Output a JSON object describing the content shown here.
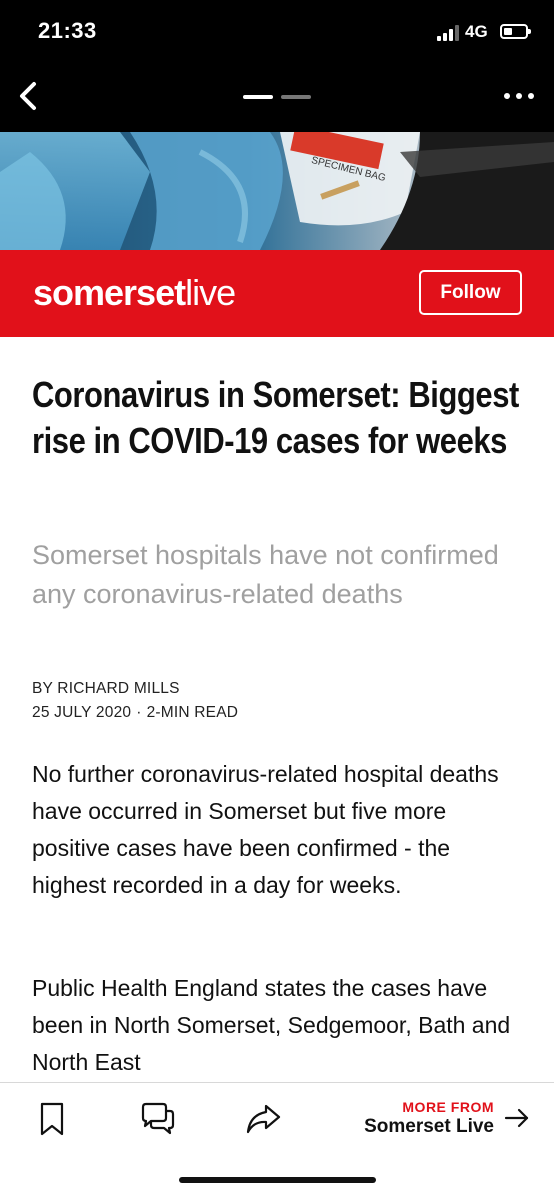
{
  "status_bar": {
    "time": "21:33",
    "network": "4G",
    "signal_bars": 3,
    "battery_level": 0.4
  },
  "nav": {
    "back_icon": "chevron-left-icon",
    "more_icon": "ellipsis-icon",
    "pages": 2,
    "active_page": 1
  },
  "brand": {
    "logo_part1": "somerset",
    "logo_part2": "live",
    "follow_label": "Follow",
    "color": "#e1111a"
  },
  "article": {
    "headline": "Coronavirus in Somerset: Biggest rise in COVID-19 cases for weeks",
    "subheadline": "Somerset hospitals have not confirmed any coronavirus-related deaths",
    "byline": "BY RICHARD MILLS",
    "date": "25 JULY 2020",
    "separator": "·",
    "read_time": "2-MIN READ",
    "paragraphs": [
      "No further coronavirus-related hospital deaths have occurred in Somerset but five more positive cases have been confirmed - the highest recorded in a day for weeks.",
      "Public Health England states the cases have been in North Somerset, Sedgemoor, Bath and North East"
    ]
  },
  "toolbar": {
    "bookmark_icon": "bookmark-icon",
    "comments_icon": "comments-icon",
    "share_icon": "share-icon",
    "more_from_label": "MORE FROM",
    "more_from_source": "Somerset Live",
    "arrow_icon": "arrow-right-icon"
  }
}
